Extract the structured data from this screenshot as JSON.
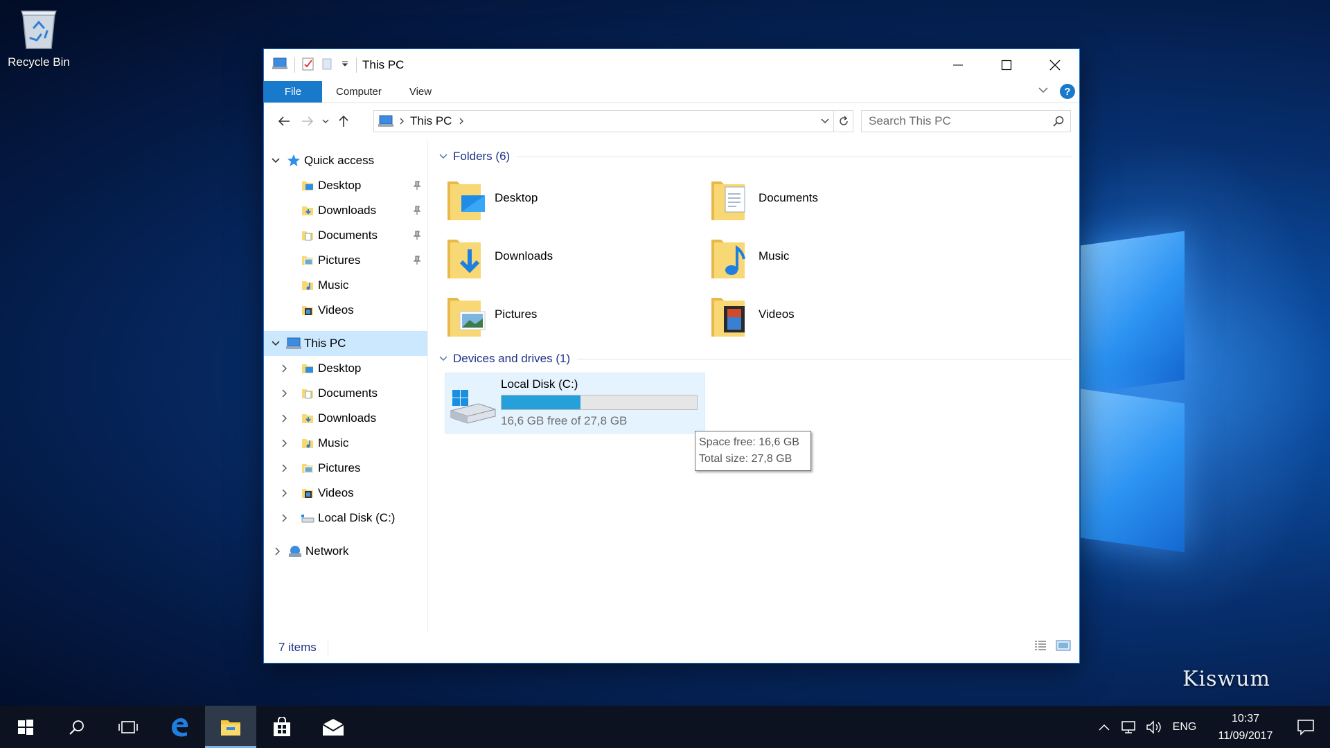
{
  "desktop": {
    "recycle_bin_label": "Recycle Bin",
    "watermark": "Kiswum"
  },
  "window": {
    "title": "This PC",
    "ribbon_tabs": {
      "file": "File",
      "computer": "Computer",
      "view": "View"
    },
    "address": {
      "crumb": "This PC"
    },
    "search": {
      "placeholder": "Search This PC"
    }
  },
  "navpane": {
    "quick_access": {
      "label": "Quick access",
      "items": [
        {
          "label": "Desktop",
          "pinned": true
        },
        {
          "label": "Downloads",
          "pinned": true
        },
        {
          "label": "Documents",
          "pinned": true
        },
        {
          "label": "Pictures",
          "pinned": true
        },
        {
          "label": "Music",
          "pinned": false
        },
        {
          "label": "Videos",
          "pinned": false
        }
      ]
    },
    "this_pc": {
      "label": "This PC",
      "items": [
        {
          "label": "Desktop"
        },
        {
          "label": "Documents"
        },
        {
          "label": "Downloads"
        },
        {
          "label": "Music"
        },
        {
          "label": "Pictures"
        },
        {
          "label": "Videos"
        },
        {
          "label": "Local Disk (C:)"
        }
      ]
    },
    "network": {
      "label": "Network"
    }
  },
  "main": {
    "folders_group": {
      "label": "Folders (6)",
      "items": [
        {
          "label": "Desktop",
          "icon": "desktop-folder-icon"
        },
        {
          "label": "Documents",
          "icon": "documents-folder-icon"
        },
        {
          "label": "Downloads",
          "icon": "downloads-folder-icon"
        },
        {
          "label": "Music",
          "icon": "music-folder-icon"
        },
        {
          "label": "Pictures",
          "icon": "pictures-folder-icon"
        },
        {
          "label": "Videos",
          "icon": "videos-folder-icon"
        }
      ]
    },
    "drives_group": {
      "label": "Devices and drives (1)",
      "drive": {
        "name": "Local Disk (C:)",
        "used_fraction": 0.403,
        "free_text": "16,6 GB free of 27,8 GB"
      }
    },
    "tooltip": {
      "line1": "Space free: 16,6 GB",
      "line2": "Total size: 27,8 GB"
    }
  },
  "statusbar": {
    "items_count": "7 items"
  },
  "taskbar": {
    "lang": "ENG",
    "time": "10:37",
    "date": "11/09/2017"
  },
  "colors": {
    "accent": "#1979ca",
    "selection": "#cce8ff",
    "drive_bar": "#26a0da",
    "group_header": "#1e3287",
    "folder_yellow": "#f8d775"
  }
}
